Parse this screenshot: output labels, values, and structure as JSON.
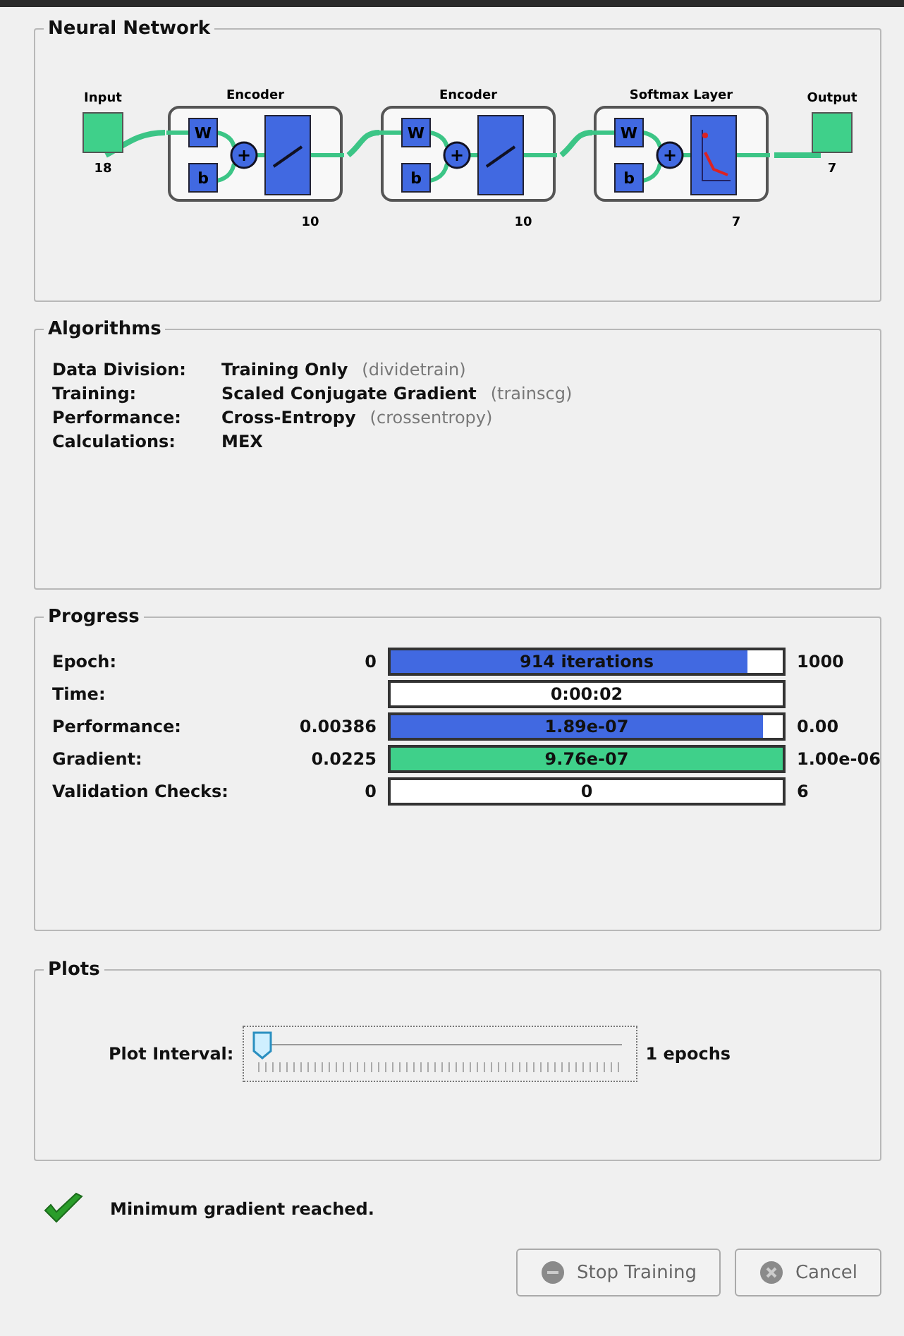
{
  "network": {
    "title": "Neural Network",
    "input": {
      "label": "Input",
      "size": "18"
    },
    "output": {
      "label": "Output",
      "size": "7"
    },
    "layers": [
      {
        "title": "Encoder",
        "size": "10",
        "kind": "linear",
        "weight": "W",
        "bias": "b",
        "sum": "+"
      },
      {
        "title": "Encoder",
        "size": "10",
        "kind": "linear",
        "weight": "W",
        "bias": "b",
        "sum": "+"
      },
      {
        "title": "Softmax Layer",
        "size": "7",
        "kind": "softmax",
        "weight": "W",
        "bias": "b",
        "sum": "+"
      }
    ]
  },
  "algorithms": {
    "title": "Algorithms",
    "rows": [
      {
        "label": "Data Division:",
        "value": "Training Only",
        "function": "(dividetrain)"
      },
      {
        "label": "Training:",
        "value": "Scaled Conjugate Gradient",
        "function": "(trainscg)"
      },
      {
        "label": "Performance:",
        "value": "Cross-Entropy",
        "function": "(crossentropy)"
      },
      {
        "label": "Calculations:",
        "value": "MEX"
      }
    ]
  },
  "progress": {
    "title": "Progress",
    "rows": [
      {
        "label": "Epoch:",
        "start": "0",
        "bar": "914 iterations",
        "kind": "blue",
        "level": 0.91,
        "end": "1000"
      },
      {
        "label": "Time:",
        "bar": "0:00:02",
        "kind": "plain"
      },
      {
        "label": "Performance:",
        "start": "0.00386",
        "bar": "1.89e-07",
        "kind": "blue",
        "level": 0.95,
        "end": "0.00"
      },
      {
        "label": "Gradient:",
        "start": "0.0225",
        "bar": "9.76e-07",
        "kind": "green",
        "level": 1,
        "end": "1.00e-06"
      },
      {
        "label": "Validation Checks:",
        "start": "0",
        "bar": "0",
        "kind": "plain",
        "end": "6"
      }
    ]
  },
  "plots": {
    "title": "Plots",
    "label": "Plot Interval:",
    "level": 0,
    "reading": "1 epochs"
  },
  "status": "Minimum gradient reached.",
  "buttons": [
    {
      "label": "Stop Training",
      "kind": "stop",
      "disabled": true
    },
    {
      "label": "Cancel",
      "kind": "cancel",
      "disabled": true
    }
  ]
}
